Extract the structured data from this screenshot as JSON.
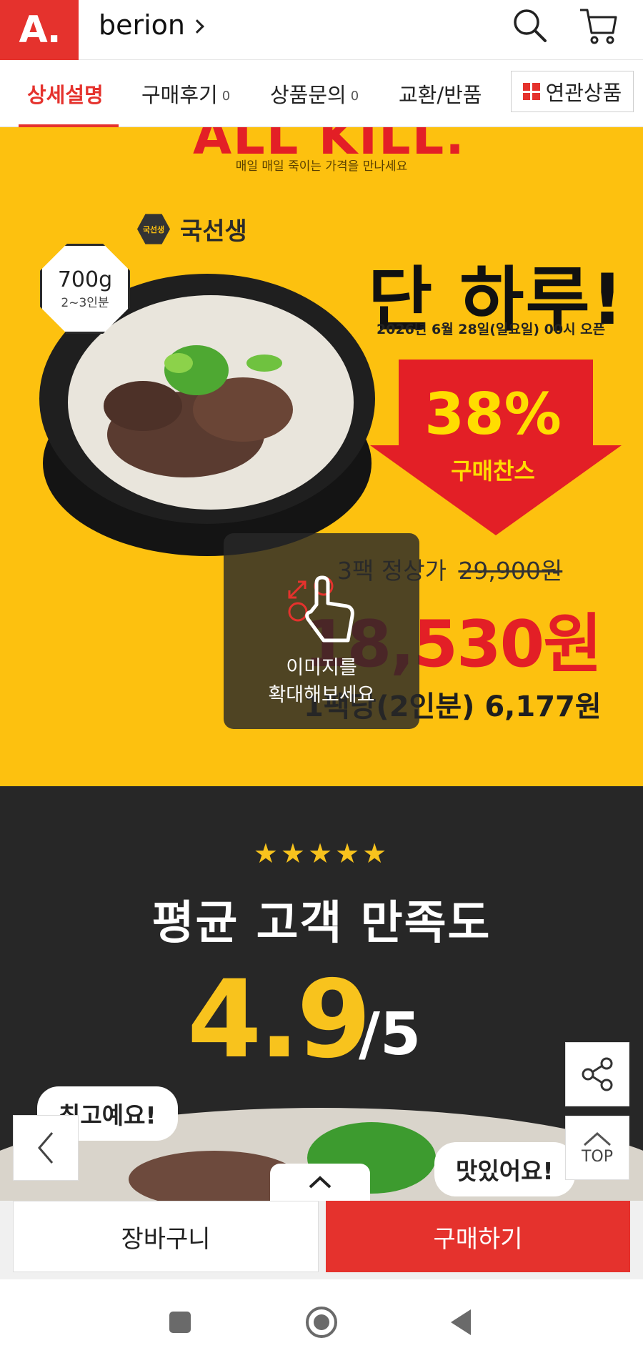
{
  "header": {
    "logo": "A.",
    "store_name": "berion",
    "icons": [
      "search-icon",
      "cart-icon"
    ]
  },
  "tabs": [
    {
      "label": "상세설명",
      "count": "",
      "active": true
    },
    {
      "label": "구매후기",
      "count": "0",
      "active": false
    },
    {
      "label": "상품문의",
      "count": "0",
      "active": false
    },
    {
      "label": "교환/반품",
      "count": "",
      "active": false
    }
  ],
  "related_button": {
    "label": "연관상품"
  },
  "promo": {
    "top_title": "ALL KILL.",
    "subtitle": "매일 매일 죽이는 가격을 만나세요",
    "brand": "국선생",
    "brand_mark": "국선생",
    "weight": "700g",
    "servings": "2~3인분",
    "headline": "단 하루!",
    "date": "2026년 6월 28일(일요일) 00시 오픈",
    "discount": "38%",
    "discount_label": "구매찬스",
    "pack_label": "3팩 정상가",
    "original_price": "29,900원",
    "sale_price": "18,530원",
    "per_pack": "1팩당(2인분) 6,177원",
    "zoom_hint_line1": "이미지를",
    "zoom_hint_line2": "확대해보세요",
    "colors": {
      "background": "#fdc10f",
      "accent": "#e31f26"
    }
  },
  "rating": {
    "stars": "★★★★★",
    "title": "평균 고객 만족도",
    "score": "4.9",
    "max": "/5",
    "bubble_1": "최고예요!",
    "bubble_2": "맛있어요!"
  },
  "floating": {
    "top_label": "TOP"
  },
  "actions": {
    "cart": "장바구니",
    "buy": "구매하기"
  },
  "colors": {
    "brand": "#e5322d",
    "star": "#f8c31d"
  }
}
